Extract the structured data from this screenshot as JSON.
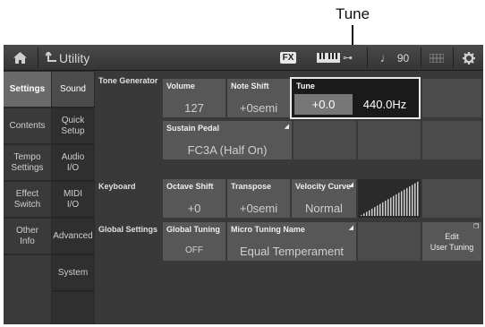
{
  "annotation": {
    "label": "Tune"
  },
  "titlebar": {
    "title": "Utility",
    "fx": "FX",
    "tempo": "90",
    "home_icon": "home-icon",
    "back_icon": "back-arrow-icon",
    "keyboard_icon": "keyboard-icon",
    "note_icon": "note-icon",
    "grid_icon": "grid-icon",
    "gear_icon": "gear-icon"
  },
  "left_tabs": [
    {
      "label": "Settings",
      "active": true
    },
    {
      "label": "Contents",
      "active": false
    },
    {
      "label": "Tempo\nSettings",
      "active": false
    },
    {
      "label": "Effect\nSwitch",
      "active": false
    },
    {
      "label": "Other\nInfo",
      "active": false
    },
    {
      "label": "",
      "active": false
    }
  ],
  "sub_tabs": [
    {
      "label": "Sound",
      "active": true
    },
    {
      "label": "Quick\nSetup",
      "active": false
    },
    {
      "label": "Audio\nI/O",
      "active": false
    },
    {
      "label": "MIDI\nI/O",
      "active": false
    },
    {
      "label": "Advanced",
      "active": false
    },
    {
      "label": "System",
      "active": false
    }
  ],
  "sections": {
    "tone_generator": "Tone Generator",
    "keyboard": "Keyboard",
    "global_settings": "Global Settings"
  },
  "params": {
    "volume": {
      "label": "Volume",
      "value": "127"
    },
    "note_shift": {
      "label": "Note Shift",
      "value": "+0semi"
    },
    "tune": {
      "label": "Tune",
      "value": "+0.0",
      "hz": "440.0Hz"
    },
    "sustain_pedal": {
      "label": "Sustain Pedal",
      "value": "FC3A (Half On)"
    },
    "octave_shift": {
      "label": "Octave Shift",
      "value": "+0"
    },
    "transpose": {
      "label": "Transpose",
      "value": "+0semi"
    },
    "velocity_curve": {
      "label": "Velocity Curve",
      "value": "Normal"
    },
    "global_tuning": {
      "label": "Global Tuning",
      "value": "OFF"
    },
    "micro_tuning_name": {
      "label": "Micro Tuning Name",
      "value": "Equal Temperament"
    },
    "edit_user_tuning": {
      "label": "Edit\nUser Tuning"
    }
  },
  "colors": {
    "screen_bg": "#2a2a2a",
    "param_bg": "#575757",
    "highlight_border": "#e8e8e8"
  }
}
